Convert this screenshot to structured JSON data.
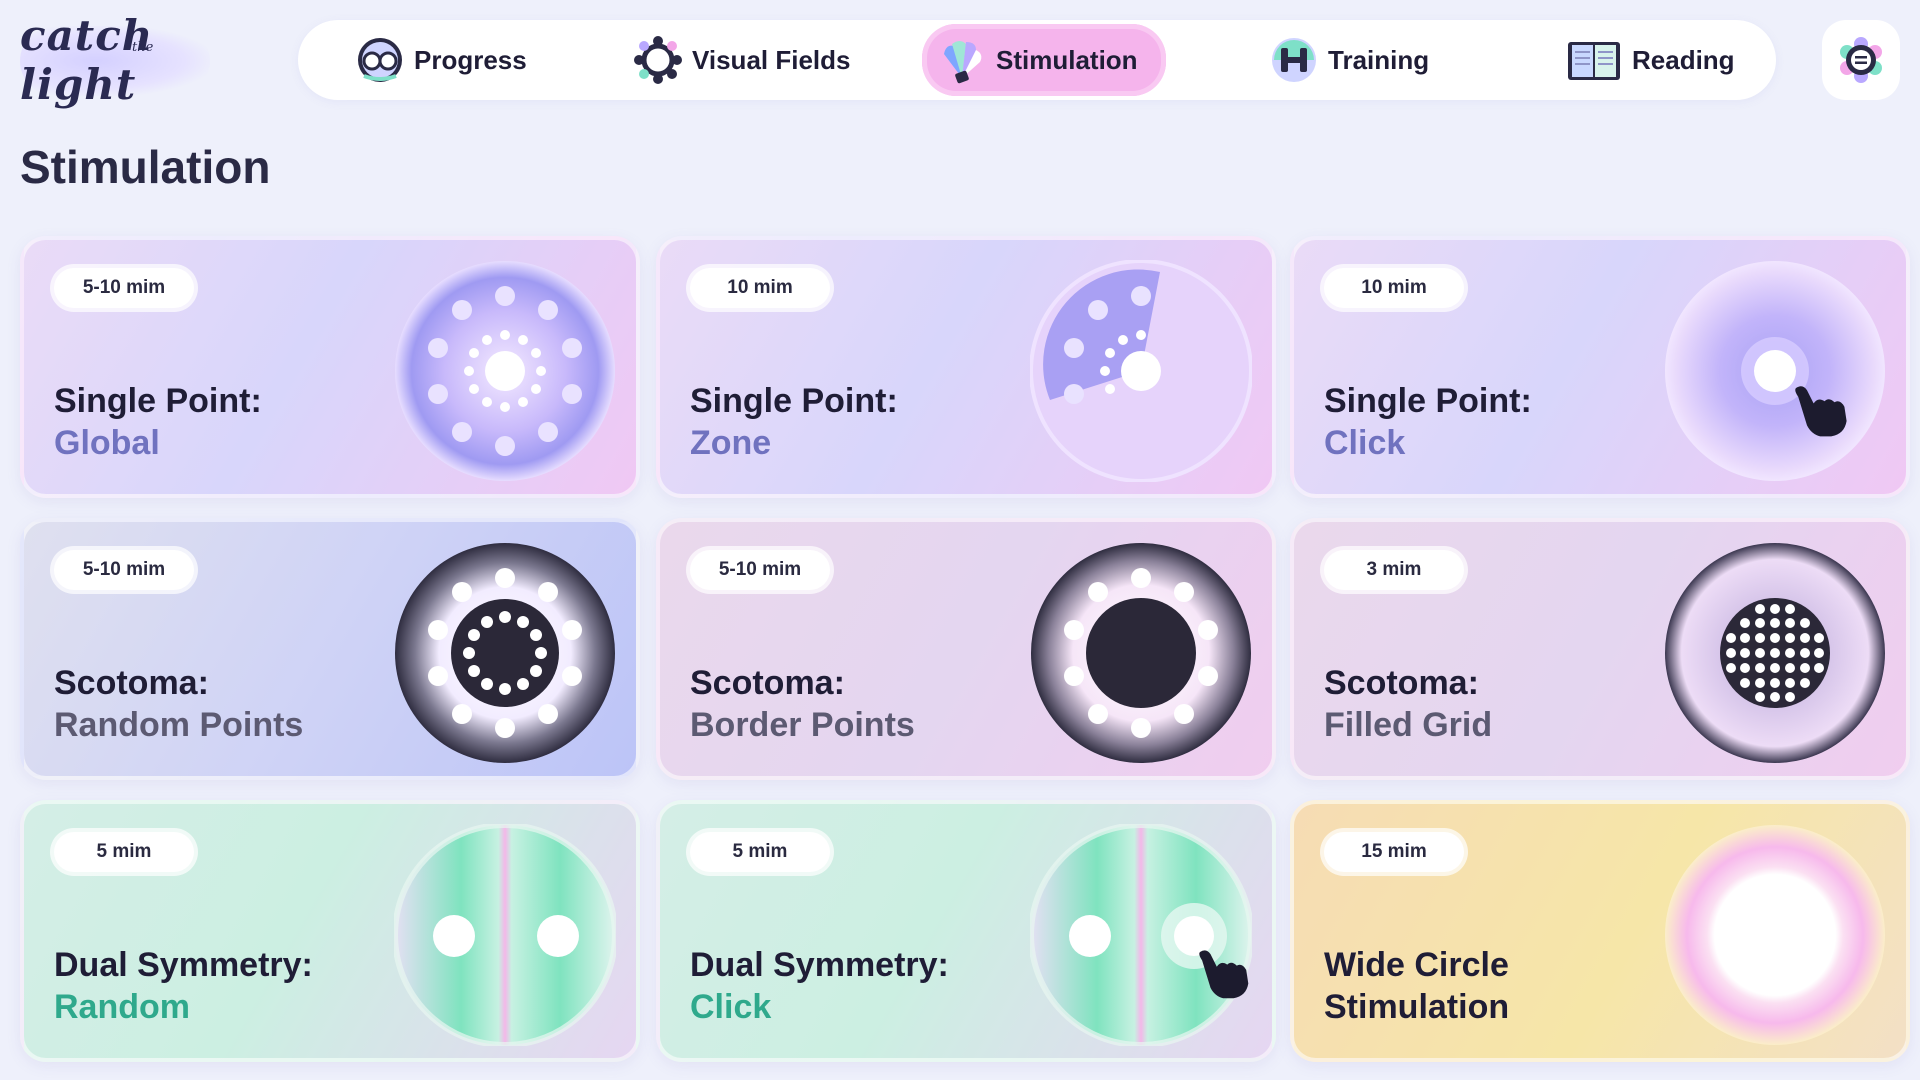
{
  "app": {
    "logo_text": "catch",
    "logo_text_light": "light",
    "logo_text_the": "the"
  },
  "nav": {
    "items": [
      {
        "label": "Progress",
        "icon": "owl-eyes-icon"
      },
      {
        "label": "Visual Fields",
        "icon": "visual-field-grid-icon"
      },
      {
        "label": "Stimulation",
        "icon": "light-burst-icon",
        "active": true
      },
      {
        "label": "Training",
        "icon": "dumbbell-icon"
      },
      {
        "label": "Reading",
        "icon": "open-book-icon"
      }
    ],
    "settings_icon": "settings-gear-icon"
  },
  "page": {
    "title": "Stimulation"
  },
  "colors": {
    "background": "#eef0fb",
    "active_nav": "#f5b4ec",
    "accent_violet": "#7072bf",
    "accent_teal": "#2fa98c"
  },
  "cards": [
    {
      "duration": "5-10 mim",
      "title_1": "Single Point:",
      "title_2": "Global"
    },
    {
      "duration": "10 mim",
      "title_1": "Single Point:",
      "title_2": "Zone"
    },
    {
      "duration": "10 mim",
      "title_1": "Single Point:",
      "title_2": "Click"
    },
    {
      "duration": "5-10 mim",
      "title_1": "Scotoma:",
      "title_2": "Random Points"
    },
    {
      "duration": "5-10 mim",
      "title_1": "Scotoma:",
      "title_2": "Border Points"
    },
    {
      "duration": "3 mim",
      "title_1": "Scotoma:",
      "title_2": "Filled Grid"
    },
    {
      "duration": "5 mim",
      "title_1": "Dual Symmetry:",
      "title_2": "Random"
    },
    {
      "duration": "5 mim",
      "title_1": "Dual Symmetry:",
      "title_2": "Click"
    },
    {
      "duration": "15 mim",
      "title_1": "Wide Circle",
      "title_2": "Stimulation"
    }
  ]
}
